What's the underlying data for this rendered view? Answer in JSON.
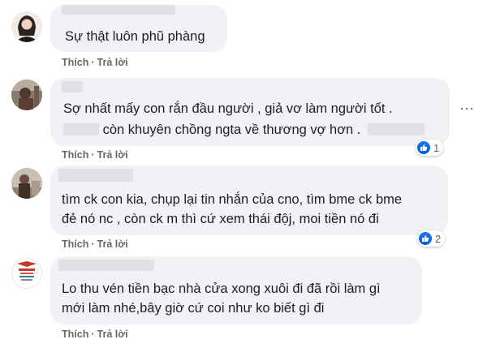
{
  "comments": [
    {
      "lines": [
        "Sự thật luôn phũ phàng"
      ],
      "actions": {
        "like": "Thích",
        "reply": "Trả lời"
      }
    },
    {
      "lines": [
        "Sợ nhất mấy con rắn đầu người , giả vơ làm người tốt .",
        "còn khuyên chồng ngta về thương vợ hơn ."
      ],
      "actions": {
        "like": "Thích",
        "reply": "Trả lời"
      },
      "reaction_count": "1"
    },
    {
      "lines": [
        "tìm ck con kia, chụp lại tin nhắn của cno, tìm bme ck bme",
        "đẻ nó nc , còn ck m thì cứ xem thái độj, moi tiền nó đi"
      ],
      "actions": {
        "like": "Thích",
        "reply": "Trả lời"
      },
      "reaction_count": "2"
    },
    {
      "lines": [
        "Lo thu vén tiền bạc nhà cửa xong xuôi đi đã rồi làm gì",
        "mới làm nhé,bây giờ cứ coi như ko biết gì đi"
      ],
      "actions": {
        "like": "Thích",
        "reply": "Trả lời"
      }
    }
  ],
  "colors": {
    "bubble": "#f0f2f5",
    "text": "#1c1e21",
    "meta": "#65676b",
    "like": "#1877f2"
  },
  "icons": {
    "more": "more-horizontal-icon",
    "reaction": "like-icon"
  }
}
